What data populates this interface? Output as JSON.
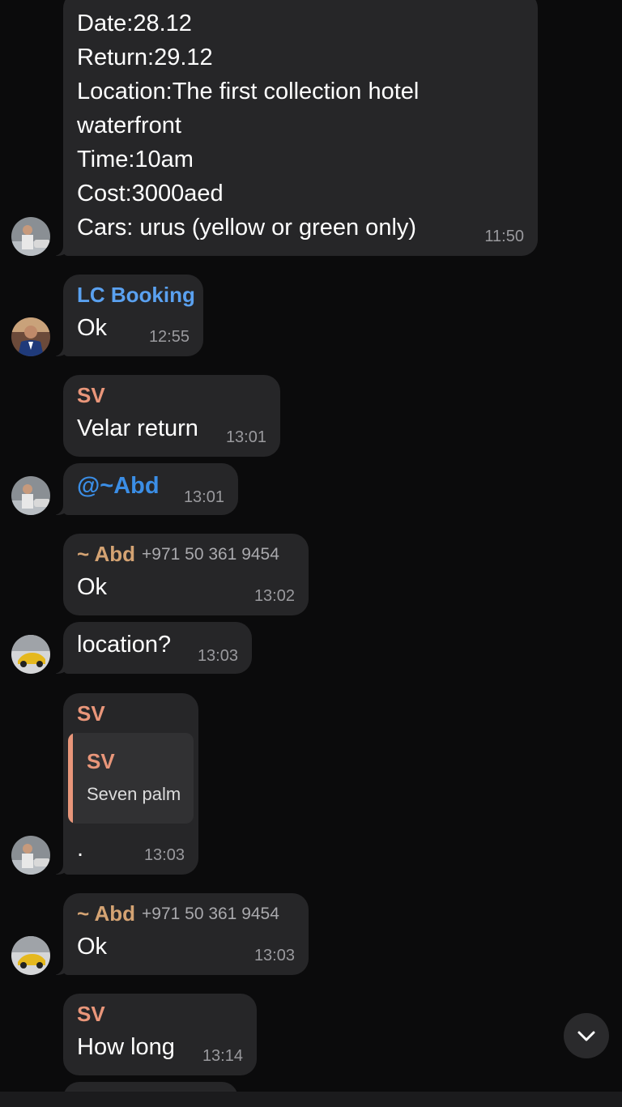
{
  "colors": {
    "background": "#0b0b0c",
    "bubble": "#262628",
    "sender_sv": "#e9967a",
    "sender_lc": "#5aa1f0",
    "sender_abd": "#d4a373",
    "mention": "#3b8ee6",
    "timestamp": "#9a9a9e"
  },
  "messages": [
    {
      "lines": [
        "Date:28.12",
        "Return:29.12",
        "Location:The first collection hotel",
        "waterfront",
        "Time:10am",
        "Cost:3000aed",
        "Cars: urus (yellow or green only)"
      ],
      "time": "11:50",
      "avatar": "man-by-car-avatar"
    },
    {
      "sender": "LC Booking",
      "text": "Ok",
      "time": "12:55",
      "avatar": "man-in-suit-avatar"
    },
    {
      "sender": "SV",
      "text": "Velar return",
      "time": "13:01"
    },
    {
      "mention": "@~Abd",
      "time": "13:01",
      "avatar": "man-by-car-avatar"
    },
    {
      "sender": "~ Abd",
      "phone": "+971 50 361 9454",
      "text": "Ok",
      "time": "13:02"
    },
    {
      "text": "location?",
      "time": "13:03",
      "avatar": "yellow-car-avatar"
    },
    {
      "sender": "SV",
      "reply": {
        "sender": "SV",
        "text": "Seven palm"
      },
      "text": ".",
      "time": "13:03",
      "avatar": "man-by-car-avatar"
    },
    {
      "sender": "~ Abd",
      "phone": "+971 50 361 9454",
      "text": "Ok",
      "time": "13:03",
      "avatar": "yellow-car-avatar"
    },
    {
      "sender": "SV",
      "text": "How long",
      "time": "13:14"
    }
  ],
  "scroll_button": {
    "icon": "chevron-down-icon"
  }
}
